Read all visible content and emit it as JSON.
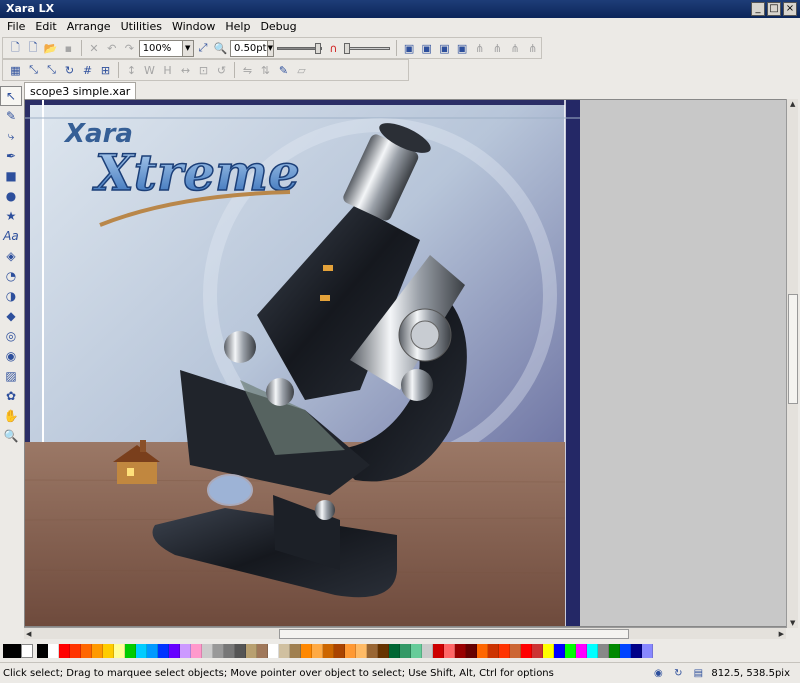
{
  "window": {
    "title": "Xara LX"
  },
  "menu": [
    {
      "label": "File"
    },
    {
      "label": "Edit"
    },
    {
      "label": "Arrange"
    },
    {
      "label": "Utilities"
    },
    {
      "label": "Window"
    },
    {
      "label": "Help"
    },
    {
      "label": "Debug"
    }
  ],
  "toolbar": {
    "zoom_value": "100%",
    "line_width_value": "0.50pt"
  },
  "tab": {
    "label": "scope3 simple.xar"
  },
  "artwork": {
    "logo_top": "Xara",
    "logo_main": "Xtreme"
  },
  "status": {
    "text": "Click select; Drag to marquee select objects; Move pointer over object to select; Use Shift, Alt, Ctrl for options",
    "coords": "812.5, 538.5pix"
  },
  "palette": [
    "#000000",
    "#ffffff",
    "#ff0000",
    "#ff3300",
    "#ff6600",
    "#ff9900",
    "#ffcc00",
    "#ffff99",
    "#00cc00",
    "#00ccff",
    "#0099ff",
    "#0033ff",
    "#6600ff",
    "#cc99ff",
    "#ff99cc",
    "#cccccc",
    "#999999",
    "#777777",
    "#555555",
    "#b8a070",
    "#a0785a",
    "#ffffff",
    "#d0c0a0",
    "#a08050",
    "#ff8800",
    "#ffaa44",
    "#cc6600",
    "#aa4400",
    "#ff9933",
    "#ffbb66",
    "#996633",
    "#663300",
    "#006633",
    "#339966",
    "#66cc99",
    "#cccccc",
    "#cc0000",
    "#ff6666",
    "#990000",
    "#660000",
    "#ff6600",
    "#cc3300",
    "#ff3300",
    "#cc6633",
    "#ff0000",
    "#cc3333",
    "#ffff00",
    "#0000ff",
    "#00ff00",
    "#ff00ff",
    "#00ffff",
    "#888888",
    "#008800",
    "#0044ff",
    "#000088",
    "#8888ff"
  ]
}
